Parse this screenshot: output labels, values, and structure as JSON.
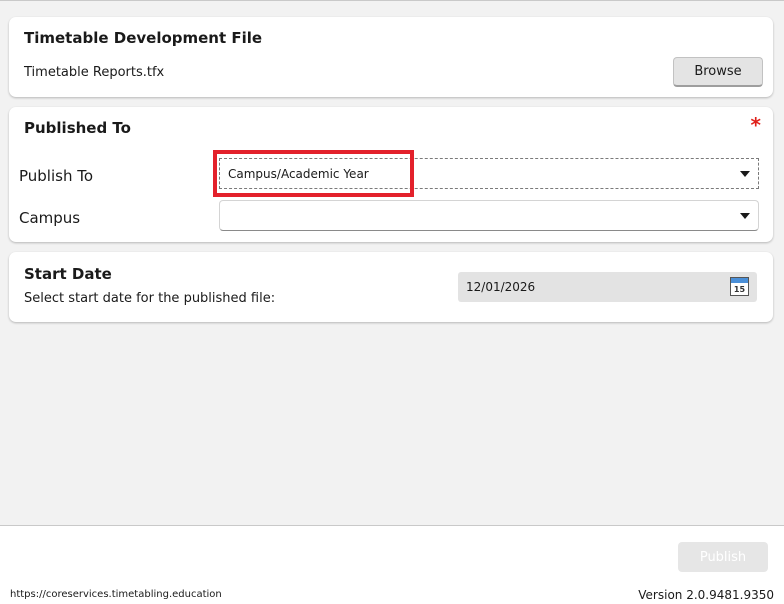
{
  "file_card": {
    "title": "Timetable Development File",
    "file_name": "Timetable Reports.tfx",
    "browse_label": "Browse"
  },
  "publish_card": {
    "title": "Published To",
    "required_mark": "*",
    "publish_to_label": "Publish To",
    "publish_to_value": "Campus/Academic Year",
    "campus_label": "Campus",
    "campus_value": ""
  },
  "date_card": {
    "title": "Start Date",
    "description": "Select start date for the published file:",
    "date_value": "12/01/2026",
    "calendar_icon_text": "15"
  },
  "footer": {
    "publish_label": "Publish",
    "url": "https://coreservices.timetabling.education",
    "version": "Version 2.0.9481.9350"
  },
  "colors": {
    "highlight": "#e3212b",
    "required": "#e0211b"
  },
  "icons": {
    "dropdown": "chevron-down-icon",
    "calendar": "calendar-icon"
  }
}
